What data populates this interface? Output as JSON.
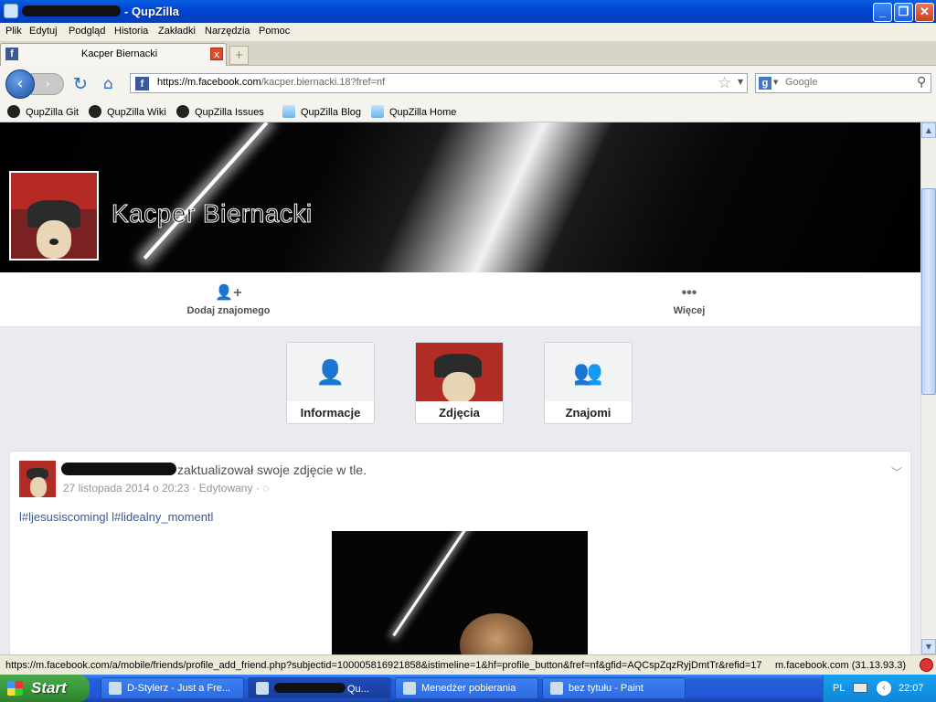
{
  "window": {
    "title_suffix": "- QupZilla",
    "min_label": "_",
    "max_label": "❐",
    "close_label": "✕"
  },
  "menu": [
    "Plik",
    "Edytuj",
    "Podgląd",
    "Historia",
    "Zakładki",
    "Narzędzia",
    "Pomoc"
  ],
  "tab": {
    "favicon": "f",
    "label": "Kacper Biernacki",
    "close": "x",
    "new_tab": "+"
  },
  "nav": {
    "back": "‹",
    "forward": "›",
    "reload": "↻",
    "home": "⌂",
    "favicon": "f",
    "url_host": "https://m.facebook.com",
    "url_rest": "/kacper.biernacki.18?fref=nf",
    "star": "☆",
    "dropdown": "▼",
    "search_engine": "g",
    "search_placeholder": "Google",
    "search_icon": "⚲"
  },
  "bookmarks": [
    "QupZilla Git",
    "QupZilla Wiki",
    "QupZilla Issues",
    "QupZilla Blog",
    "QupZilla Home"
  ],
  "profile": {
    "name": "Kacper Biernacki",
    "actions": [
      {
        "label": "Dodaj znajomego",
        "icon": "👤+"
      },
      {
        "label": "Więcej",
        "icon": "•••"
      }
    ],
    "tiles": [
      "Informacje",
      "Zdjęcia",
      "Znajomi"
    ]
  },
  "post": {
    "action_text": "zaktualizował swoje zdjęcie w tle.",
    "meta": "27 listopada 2014 o 20:23 · Edytowany ·",
    "chevron": "﹀",
    "tags": "l#ljesusiscomingl l#lidealny_momentl"
  },
  "scrollbar": {
    "up": "▲",
    "down": "▼"
  },
  "status": {
    "url": "https://m.facebook.com/a/mobile/friends/profile_add_friend.php?subjectid=100005816921858&istimeline=1&hf=profile_button&fref=nf&gfid=AQCspZqzRyjDmtTr&refid=17",
    "host": "m.facebook.com (31.13.93.3)"
  },
  "taskbar": {
    "start": "Start",
    "items": [
      "D-Stylerz - Just a Fre...",
      "Qu...",
      "Menedżer pobierania",
      "bez tytułu - Paint"
    ],
    "lang": "PL",
    "clock": "22:07",
    "tray_arrow": "‹"
  }
}
